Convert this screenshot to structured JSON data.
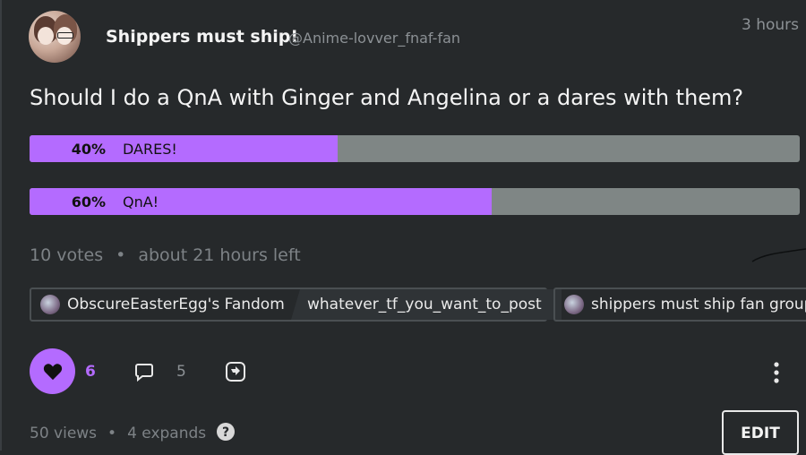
{
  "post": {
    "author_name": "Shippers must ship!",
    "author_handle": "@Anime-lovver_fnaf-fan",
    "time": "3 hours",
    "question": "Should I do a QnA with Ginger and Angelina or a dares with them?"
  },
  "poll": {
    "options": [
      {
        "percent_label": "40%",
        "label": "DARES!",
        "fraction": 0.4
      },
      {
        "percent_label": "60%",
        "label": "QnA!",
        "fraction": 0.6
      }
    ],
    "votes": "10 votes",
    "time_left": "about 21 hours left"
  },
  "tags": [
    {
      "label": "ObscureEasterEgg's Fandom",
      "icon": "fandom-avatar-icon"
    },
    {
      "label": "whatever_tf_you_want_to_post"
    },
    {
      "label": "shippers must ship fan group",
      "icon": "group-avatar-icon"
    }
  ],
  "actions": {
    "like_count": "6",
    "comment_count": "5"
  },
  "footer": {
    "views": "50 views",
    "expands": "4 expands",
    "edit_label": "EDIT"
  },
  "colors": {
    "background": "#26292b",
    "accent": "#b46bff",
    "poll_track": "#7f8685",
    "muted_text": "#7d8286"
  },
  "separator": "•"
}
